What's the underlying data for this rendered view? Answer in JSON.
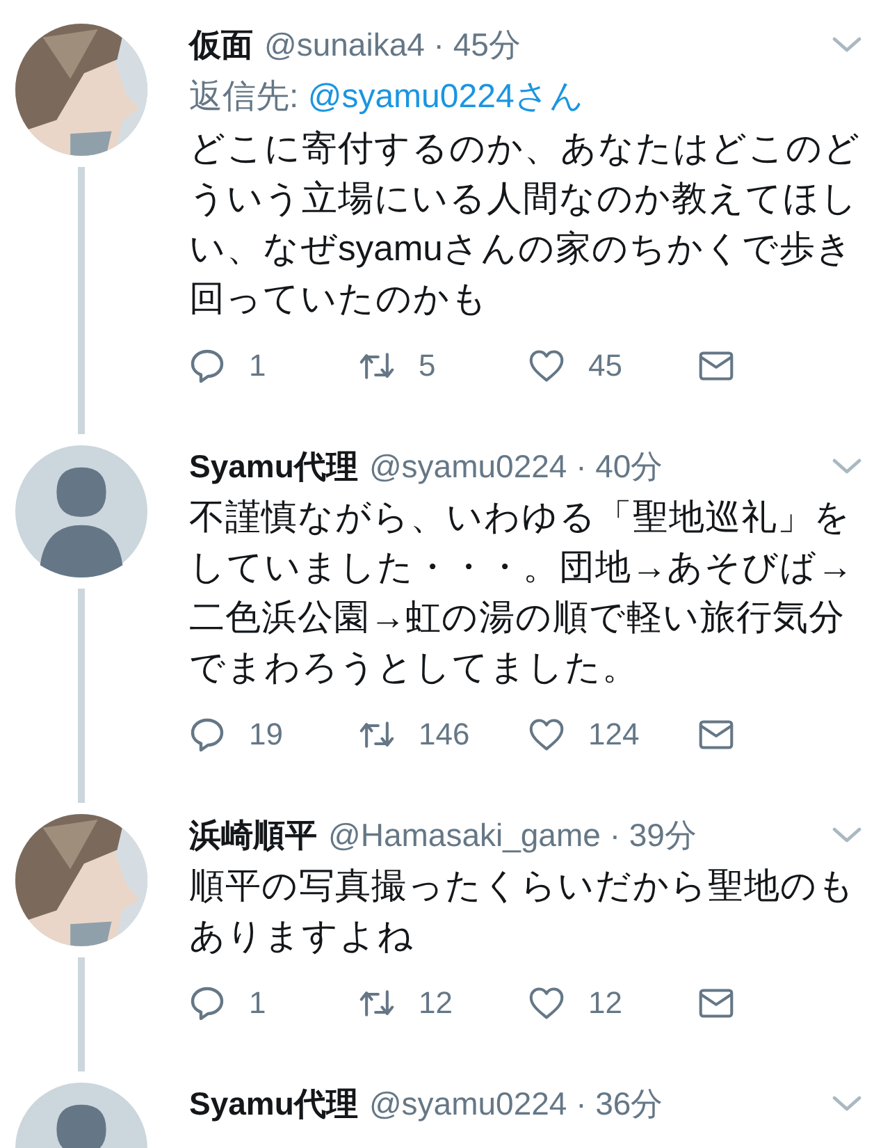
{
  "tweets": [
    {
      "name": "仮面",
      "meta": "@sunaika4 · 45分",
      "reply_to": {
        "label": "返信先:",
        "handle": "@syamu0224さん"
      },
      "text": "どこに寄付するのか、あなたはどこのどういう立場にいる人間なのか教えてほしい、なぜsyamuさんの家のちかくで歩き回っていたのかも",
      "counts": {
        "reply": "1",
        "retweet": "5",
        "like": "45"
      }
    },
    {
      "avatar": {
        "kind": "default"
      },
      "name": "Syamu代理",
      "meta": "@syamu0224 · 40分",
      "text": "不謹慎ながら、いわゆる「聖地巡礼」をしていました・・・。団地→あそびば→二色浜公園→虹の湯の順で軽い旅行気分でまわろうとしてました。",
      "counts": {
        "reply": "19",
        "retweet": "146",
        "like": "124"
      }
    },
    {
      "name": "浜崎順平",
      "meta": "@Hamasaki_game · 39分",
      "text": "順平の写真撮ったくらいだから聖地のもありますよね",
      "counts": {
        "reply": "1",
        "retweet": "12",
        "like": "12"
      }
    },
    {
      "avatar": {
        "kind": "default"
      },
      "name": "Syamu代理",
      "meta": "@syamu0224 · 36分"
    }
  ]
}
